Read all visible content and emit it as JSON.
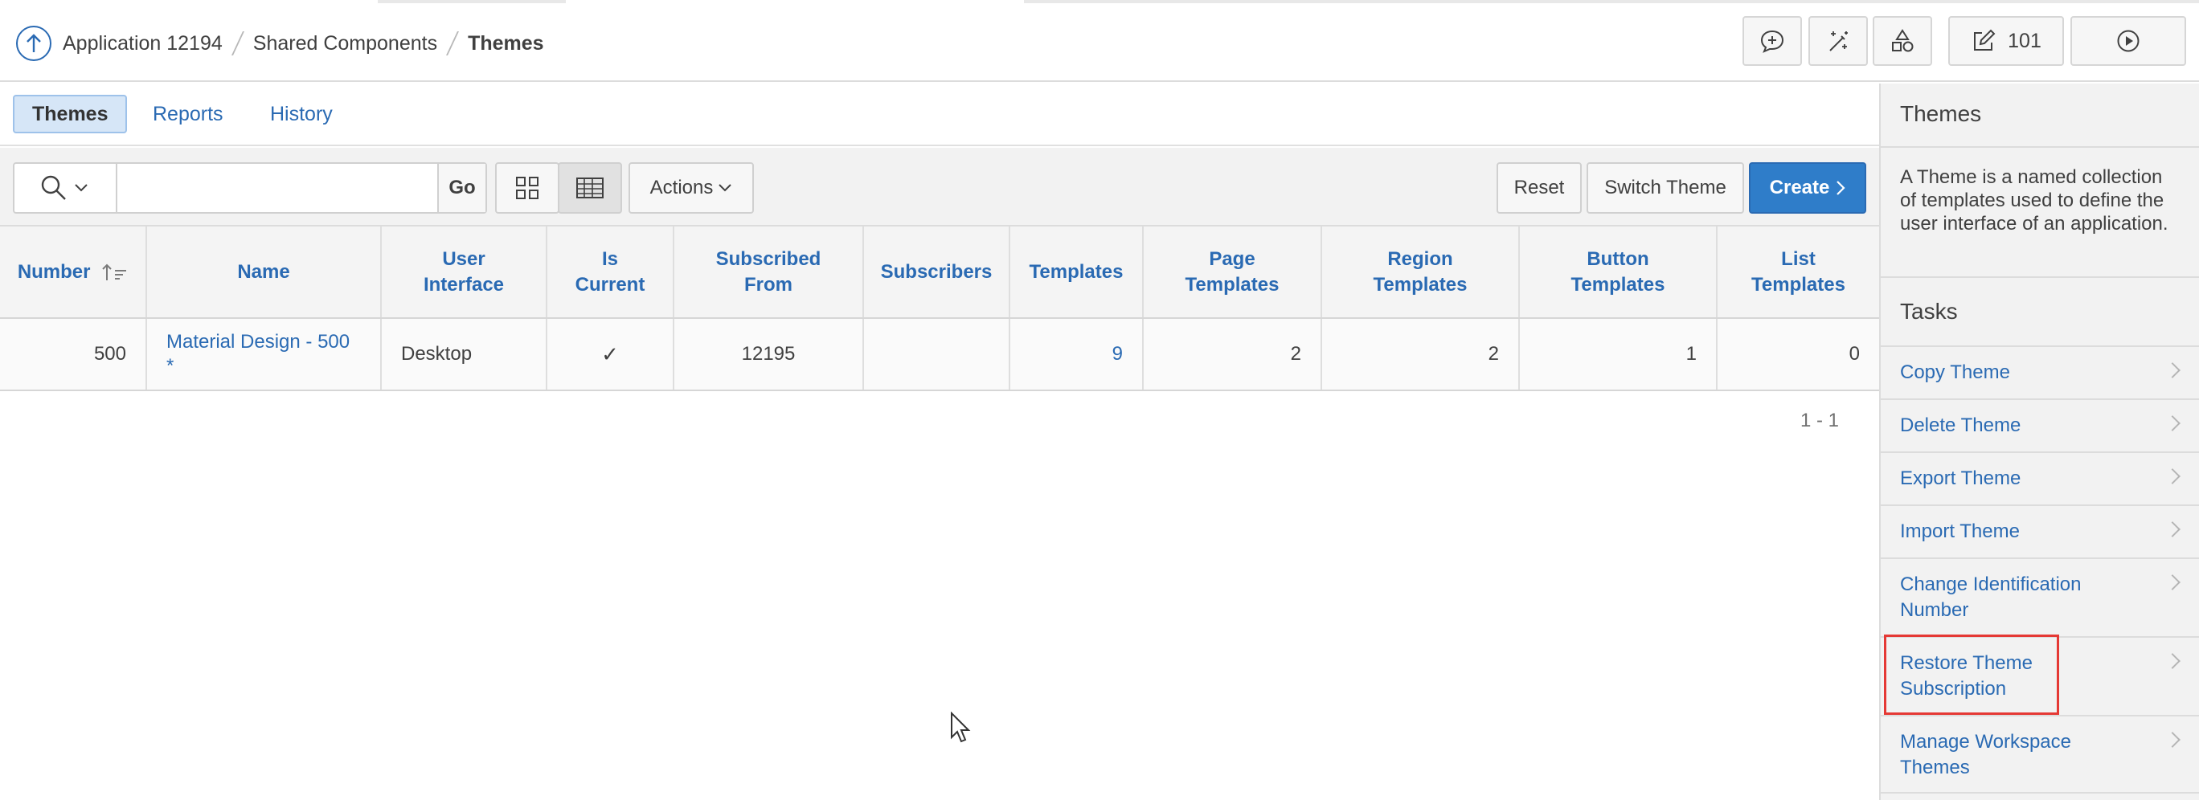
{
  "breadcrumb": {
    "items": [
      "Application 12194",
      "Shared Components",
      "Themes"
    ]
  },
  "header": {
    "page_number": "101"
  },
  "tabs": [
    "Themes",
    "Reports",
    "History"
  ],
  "toolbar": {
    "search_value": "",
    "go_label": "Go",
    "actions_label": "Actions",
    "reset_label": "Reset",
    "switch_theme_label": "Switch Theme",
    "create_label": "Create"
  },
  "table": {
    "columns": [
      {
        "line1": "Number",
        "line2": ""
      },
      {
        "line1": "Name",
        "line2": ""
      },
      {
        "line1": "User",
        "line2": "Interface"
      },
      {
        "line1": "Is",
        "line2": "Current"
      },
      {
        "line1": "Subscribed",
        "line2": "From"
      },
      {
        "line1": "Subscribers",
        "line2": ""
      },
      {
        "line1": "Templates",
        "line2": ""
      },
      {
        "line1": "Page",
        "line2": "Templates"
      },
      {
        "line1": "Region",
        "line2": "Templates"
      },
      {
        "line1": "Button",
        "line2": "Templates"
      },
      {
        "line1": "List",
        "line2": "Templates"
      }
    ],
    "rows": [
      {
        "number": "500",
        "name": "Material Design - 500 *",
        "user_interface": "Desktop",
        "is_current": "✓",
        "subscribed_from": "12195",
        "subscribers": "",
        "templates": "9",
        "page_templates": "2",
        "region_templates": "2",
        "button_templates": "1",
        "list_templates": "0"
      }
    ],
    "pagination": "1 - 1"
  },
  "side_panel": {
    "title": "Themes",
    "description": "A Theme is a named collection of templates used to define the user interface of an application.",
    "tasks_title": "Tasks",
    "tasks": [
      "Copy Theme",
      "Delete Theme",
      "Export Theme",
      "Import Theme",
      "Change Identification Number",
      "Restore Theme Subscription",
      "Manage Workspace Themes"
    ]
  },
  "colors": {
    "link": "#2a6ab3",
    "primary_button": "#2f7dc9",
    "active_tab": "#d6e6f7",
    "highlight": "#e53935"
  }
}
